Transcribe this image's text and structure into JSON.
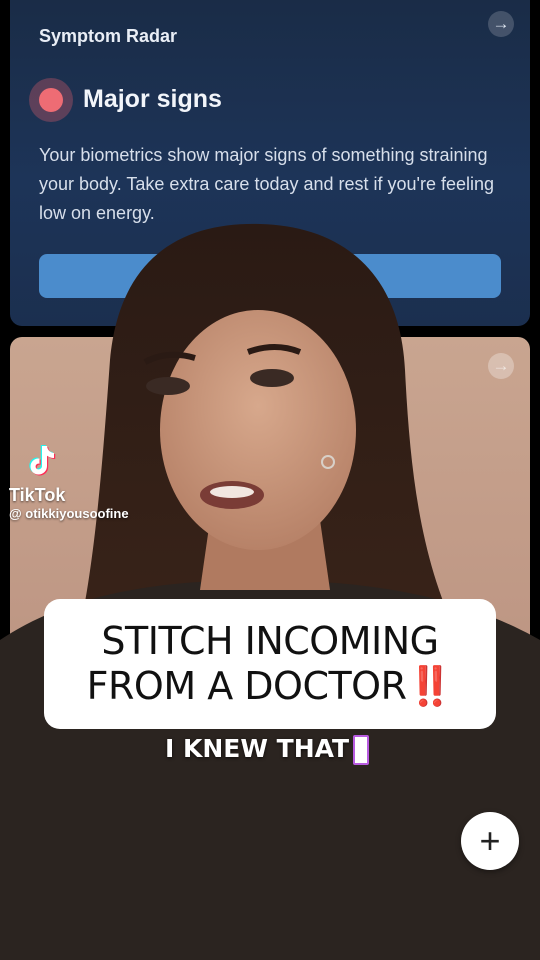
{
  "symptom_card": {
    "title": "Symptom Radar",
    "status": "Major signs",
    "description": "Your biometrics show major signs of something straining your body. Take extra care today and rest if you're feeling low on energy.",
    "button_label": "e",
    "status_color": "#ee6c74",
    "arrow_icon": "arrow-right-icon"
  },
  "watermark": {
    "brand": "TikTok",
    "handle": "@ otikkiyousoofine"
  },
  "caption": {
    "line1": "STITCH INCOMING",
    "line2": "FROM A DOCTOR",
    "mark": "‼️"
  },
  "subtitle": {
    "text": "I KNEW THAT"
  },
  "plus_button": {
    "label": "+"
  }
}
